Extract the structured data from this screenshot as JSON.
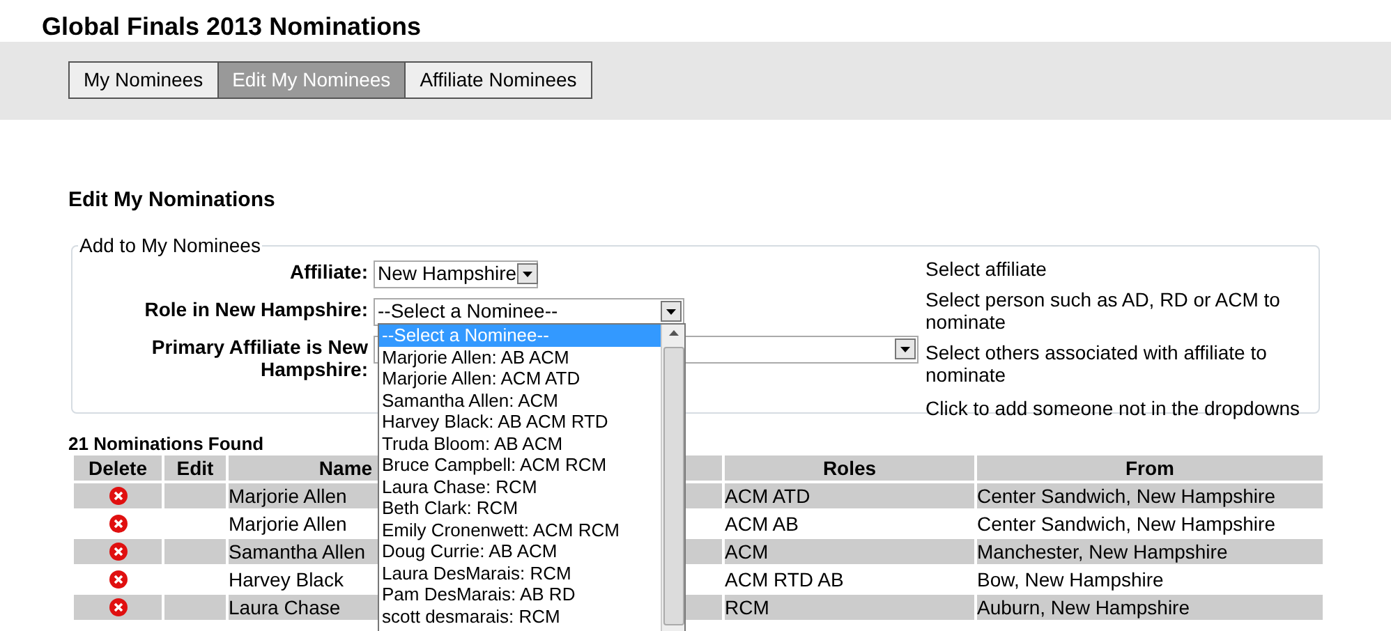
{
  "page_title": "Global Finals 2013 Nominations",
  "tabs": [
    {
      "label": "My Nominees",
      "selected": false
    },
    {
      "label": "Edit My Nominees",
      "selected": true
    },
    {
      "label": "Affiliate Nominees",
      "selected": false
    }
  ],
  "section_title": "Edit My Nominations",
  "form": {
    "legend": "Add to My Nominees",
    "fields": [
      {
        "label": "Affiliate:",
        "value": "New Hampshire",
        "help": "Select affiliate"
      },
      {
        "label": "Role in New Hampshire:",
        "value": "--Select a Nominee--",
        "help": "Select person such as AD, RD or ACM to nominate"
      },
      {
        "label": "Primary Affiliate is New Hampshire:",
        "help": "Select others associated with affiliate to nominate"
      }
    ],
    "add_hint": "Click to add someone not in the dropdowns"
  },
  "dropdown": {
    "options": [
      {
        "label": "--Select a Nominee--",
        "selected": true
      },
      {
        "label": "Marjorie Allen: AB ACM",
        "selected": false
      },
      {
        "label": "Marjorie Allen: ACM ATD",
        "selected": false
      },
      {
        "label": "Samantha Allen: ACM",
        "selected": false
      },
      {
        "label": "Harvey Black: AB ACM RTD",
        "selected": false
      },
      {
        "label": "Truda Bloom: AB ACM",
        "selected": false
      },
      {
        "label": "Bruce Campbell: ACM RCM",
        "selected": false
      },
      {
        "label": "Laura Chase: RCM",
        "selected": false
      },
      {
        "label": "Beth Clark: RCM",
        "selected": false
      },
      {
        "label": "Emily Cronenwett: ACM RCM",
        "selected": false
      },
      {
        "label": "Doug Currie: AB ACM",
        "selected": false
      },
      {
        "label": "Laura DesMarais: RCM",
        "selected": false
      },
      {
        "label": "Pam DesMarais: AB RD",
        "selected": false
      },
      {
        "label": "scott desmarais: RCM",
        "selected": false
      }
    ]
  },
  "table": {
    "count": "21 Nominations Found",
    "columns": [
      "Delete",
      "Edit",
      "Name",
      "Roles",
      "From"
    ],
    "rows": [
      {
        "name": "Marjorie Allen",
        "roles": "ACM ATD",
        "from": "Center Sandwich, New Hampshire"
      },
      {
        "name": "Marjorie Allen",
        "roles": "ACM AB",
        "from": "Center Sandwich, New Hampshire"
      },
      {
        "name": "Samantha Allen",
        "roles": "ACM",
        "from": "Manchester, New Hampshire"
      },
      {
        "name": "Harvey Black",
        "roles": "ACM RTD AB",
        "from": "Bow, New Hampshire"
      },
      {
        "name": "Laura Chase",
        "roles": "RCM",
        "from": "Auburn, New Hampshire"
      }
    ]
  }
}
